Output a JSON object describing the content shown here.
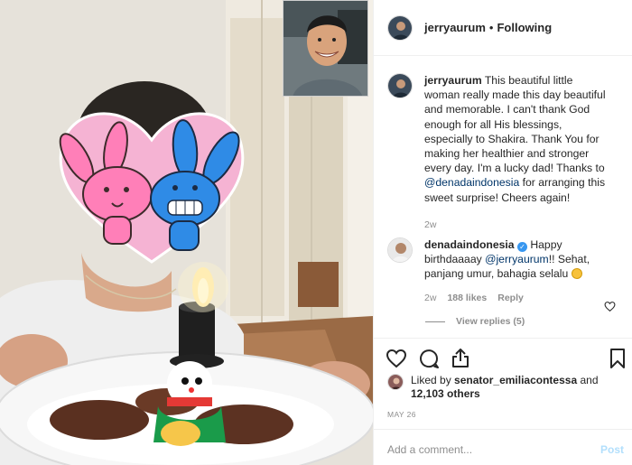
{
  "post": {
    "username": "jerryaurum",
    "separator": "•",
    "follow_status": "Following"
  },
  "caption": {
    "username": "jerryaurum",
    "text_before_mention": "This beautiful little woman really made this day beautiful and memorable. I can't thank God enough for all His blessings, especially to Shakira. Thank You for making her healthier and stronger every day. I'm a lucky dad! Thanks to",
    "mention": "@denadaindonesia",
    "text_after_mention": "for arranging this sweet surprise! Cheers again!",
    "time": "2w"
  },
  "comment": {
    "username": "denadaindonesia",
    "verified_mark": "✓",
    "text_before_mention": "Happy birthdaaaay",
    "mention": "@jerryaurum",
    "text_after_mention": "!! Sehat, panjang umur, bahagia selalu",
    "time": "2w",
    "likes": "188 likes",
    "reply_label": "Reply",
    "view_replies": "View replies (5)"
  },
  "likes_line": {
    "prefix": "Liked by",
    "user": "senator_emiliacontessa",
    "middle": "and",
    "count": "12,103 others"
  },
  "date": "MAY 26",
  "add_comment": {
    "placeholder": "Add a comment...",
    "post_label": "Post"
  },
  "icons": {
    "like": "heart-icon",
    "comment": "comment-bubble-icon",
    "share": "share-icon",
    "save": "bookmark-icon",
    "comment_like": "small-heart-icon"
  },
  "colors": {
    "link": "#003569",
    "muted": "#8e8e8e",
    "verified": "#3897f0",
    "post_disabled": "#b2dffc"
  }
}
